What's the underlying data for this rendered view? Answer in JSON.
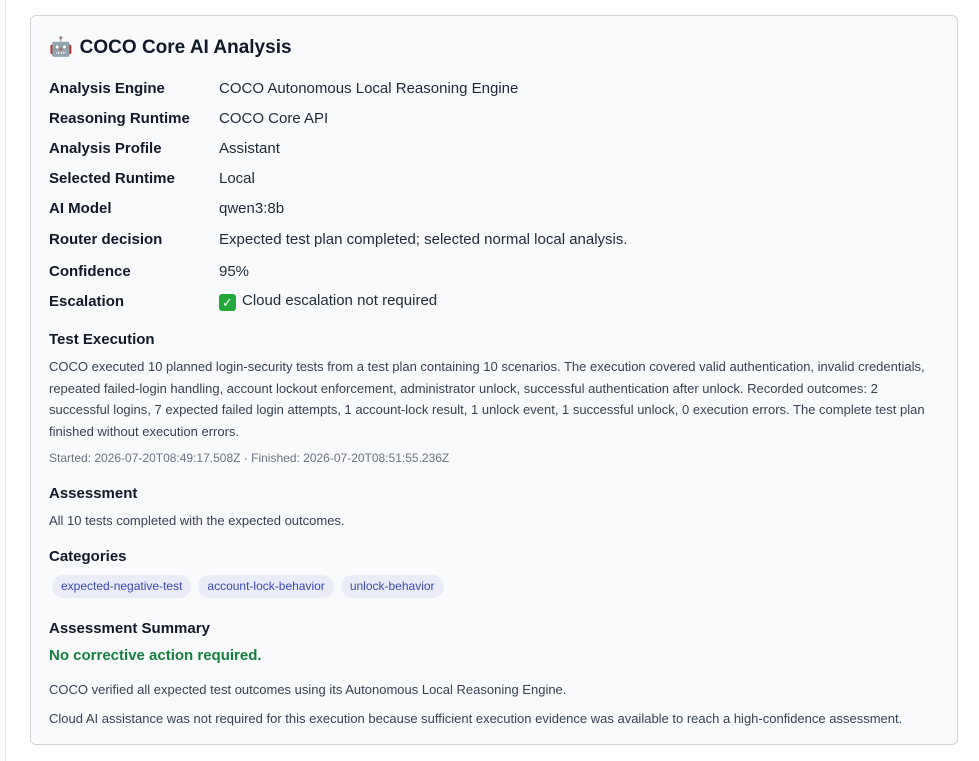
{
  "title": {
    "emoji": "🤖",
    "text": "COCO Core AI Analysis"
  },
  "details": [
    {
      "key": "Analysis Engine",
      "value": "COCO Autonomous Local Reasoning Engine"
    },
    {
      "key": "Reasoning Runtime",
      "value": "COCO Core API"
    },
    {
      "key": "Analysis Profile",
      "value": "Assistant"
    },
    {
      "key": "Selected Runtime",
      "value": "Local"
    },
    {
      "key": "AI Model",
      "value": "qwen3:8b"
    },
    {
      "key": "Router decision",
      "value": "Expected test plan completed; selected normal local analysis."
    },
    {
      "key": "Confidence",
      "value": "95%"
    },
    {
      "key": "Escalation",
      "value": "Cloud escalation not required",
      "icon": "check-mark-icon"
    }
  ],
  "test_execution": {
    "heading": "Test Execution",
    "body": "COCO executed 10 planned login-security tests from a test plan containing 10 scenarios. The execution covered valid authentication, invalid credentials, repeated failed-login handling, account lockout enforcement, administrator unlock, successful authentication after unlock. Recorded outcomes: 2 successful logins, 7 expected failed login attempts, 1 account-lock result, 1 unlock event, 1 successful unlock, 0 execution errors. The complete test plan finished without execution errors.",
    "timing": "Started: 2026-07-20T08:49:17.508Z · Finished: 2026-07-20T08:51:55.236Z"
  },
  "assessment": {
    "heading": "Assessment",
    "body": "All 10 tests completed with the expected outcomes."
  },
  "categories": {
    "heading": "Categories",
    "items": [
      "expected-negative-test",
      "account-lock-behavior",
      "unlock-behavior"
    ]
  },
  "assessment_summary": {
    "heading": "Assessment Summary",
    "status": "No corrective action required.",
    "notes": [
      "COCO verified all expected test outcomes using its Autonomous Local Reasoning Engine.",
      "Cloud AI assistance was not required for this execution because sufficient execution evidence was available to reach a high-confidence assessment."
    ]
  },
  "colors": {
    "status_green": "#15803d",
    "chip_bg": "#eaedf8",
    "chip_text": "#3b47b5",
    "card_bg": "#f8fafc"
  }
}
